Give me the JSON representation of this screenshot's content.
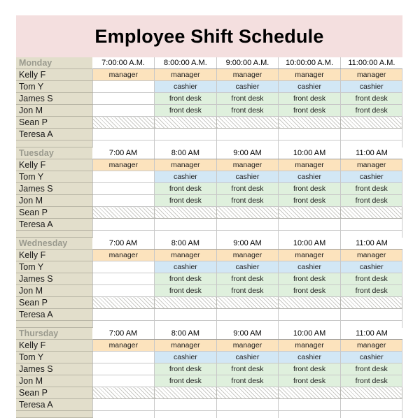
{
  "document": {
    "title": "Employee Shift Schedule",
    "colors": {
      "title_band": "#f4dfdf",
      "name_column": "#e2decb",
      "manager": "#fce3bd",
      "cashier": "#d2e7f5",
      "front_desk": "#dff0dd",
      "blocked": "#eeeeec",
      "grid_line": "#c8c8c8",
      "day_label_text": "#9a9a8e"
    },
    "shift_labels": {
      "manager": "manager",
      "cashier": "cashier",
      "front_desk": "front desk"
    },
    "employees": [
      "Kelly F",
      "Tom Y",
      "James S",
      "Jon M",
      "Sean P",
      "Teresa A"
    ],
    "days": [
      {
        "name": "Monday",
        "times": [
          "7:00:00 A.M.",
          "8:00:00 A.M.",
          "9:00:00 A.M.",
          "10:00:00 A.M.",
          "11:00:00 A.M."
        ],
        "rows": [
          {
            "employee": "Kelly F",
            "shifts": [
              "manager",
              "manager",
              "manager",
              "manager",
              "manager"
            ]
          },
          {
            "employee": "Tom Y",
            "shifts": [
              "",
              "cashier",
              "cashier",
              "cashier",
              "cashier"
            ]
          },
          {
            "employee": "James S",
            "shifts": [
              "",
              "front desk",
              "front desk",
              "front desk",
              "front desk"
            ]
          },
          {
            "employee": "Jon M",
            "shifts": [
              "",
              "front desk",
              "front desk",
              "front desk",
              "front desk"
            ]
          },
          {
            "employee": "Sean P",
            "shifts": [
              "blocked",
              "blocked",
              "blocked",
              "blocked",
              "blocked"
            ]
          },
          {
            "employee": "Teresa A",
            "shifts": [
              "",
              "",
              "",
              "",
              ""
            ]
          }
        ]
      },
      {
        "name": "Tuesday",
        "times": [
          "7:00 AM",
          "8:00 AM",
          "9:00 AM",
          "10:00 AM",
          "11:00 AM"
        ],
        "rows": [
          {
            "employee": "Kelly F",
            "shifts": [
              "manager",
              "manager",
              "manager",
              "manager",
              "manager"
            ]
          },
          {
            "employee": "Tom Y",
            "shifts": [
              "",
              "cashier",
              "cashier",
              "cashier",
              "cashier"
            ]
          },
          {
            "employee": "James S",
            "shifts": [
              "",
              "front desk",
              "front desk",
              "front desk",
              "front desk"
            ]
          },
          {
            "employee": "Jon M",
            "shifts": [
              "",
              "front desk",
              "front desk",
              "front desk",
              "front desk"
            ]
          },
          {
            "employee": "Sean P",
            "shifts": [
              "blocked",
              "blocked",
              "blocked",
              "blocked",
              "blocked"
            ]
          },
          {
            "employee": "Teresa A",
            "shifts": [
              "",
              "",
              "",
              "",
              ""
            ]
          }
        ]
      },
      {
        "name": "Wednesday",
        "times": [
          "7:00 AM",
          "8:00 AM",
          "9:00 AM",
          "10:00 AM",
          "11:00 AM"
        ],
        "rows": [
          {
            "employee": "Kelly F",
            "shifts": [
              "manager",
              "manager",
              "manager",
              "manager",
              "manager"
            ]
          },
          {
            "employee": "Tom Y",
            "shifts": [
              "",
              "cashier",
              "cashier",
              "cashier",
              "cashier"
            ]
          },
          {
            "employee": "James S",
            "shifts": [
              "",
              "front desk",
              "front desk",
              "front desk",
              "front desk"
            ]
          },
          {
            "employee": "Jon M",
            "shifts": [
              "",
              "front desk",
              "front desk",
              "front desk",
              "front desk"
            ]
          },
          {
            "employee": "Sean P",
            "shifts": [
              "blocked",
              "blocked",
              "blocked",
              "blocked",
              "blocked"
            ]
          },
          {
            "employee": "Teresa A",
            "shifts": [
              "",
              "",
              "",
              "",
              ""
            ]
          }
        ]
      },
      {
        "name": "Thursday",
        "times": [
          "7:00 AM",
          "8:00 AM",
          "9:00 AM",
          "10:00 AM",
          "11:00 AM"
        ],
        "rows": [
          {
            "employee": "Kelly F",
            "shifts": [
              "manager",
              "manager",
              "manager",
              "manager",
              "manager"
            ]
          },
          {
            "employee": "Tom Y",
            "shifts": [
              "",
              "cashier",
              "cashier",
              "cashier",
              "cashier"
            ]
          },
          {
            "employee": "James S",
            "shifts": [
              "",
              "front desk",
              "front desk",
              "front desk",
              "front desk"
            ]
          },
          {
            "employee": "Jon M",
            "shifts": [
              "",
              "front desk",
              "front desk",
              "front desk",
              "front desk"
            ]
          },
          {
            "employee": "Sean P",
            "shifts": [
              "blocked",
              "blocked",
              "blocked",
              "blocked",
              "blocked"
            ]
          },
          {
            "employee": "Teresa A",
            "shifts": [
              "",
              "",
              "",
              "",
              ""
            ]
          }
        ]
      }
    ]
  }
}
